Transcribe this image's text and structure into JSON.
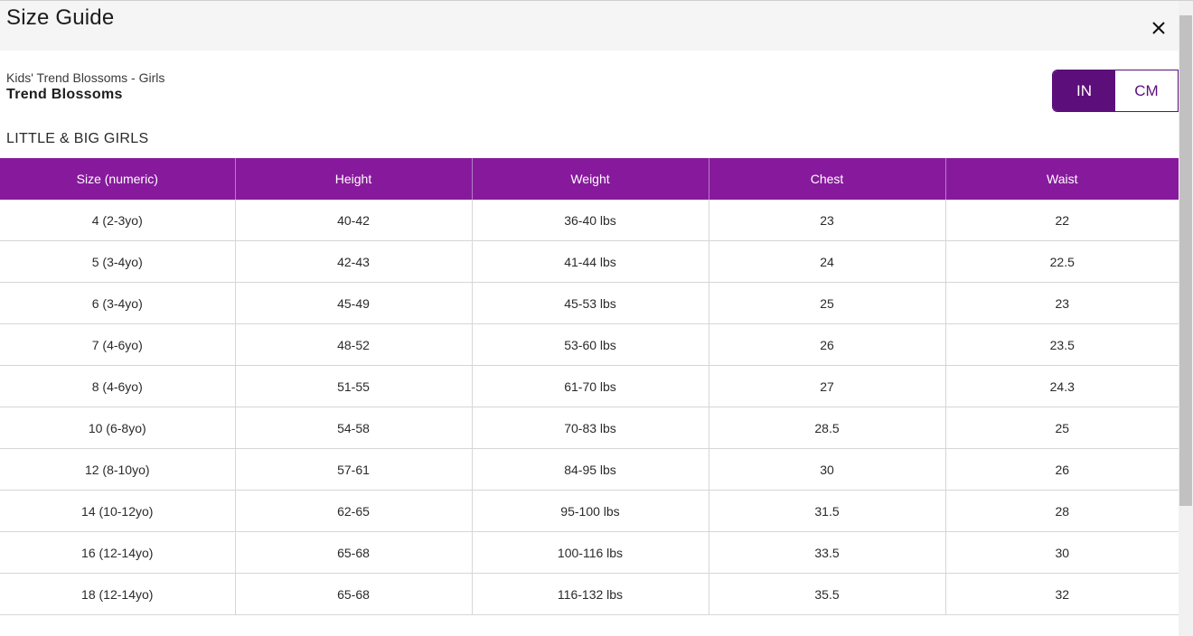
{
  "modal": {
    "title": "Size Guide",
    "close_icon": "close-icon"
  },
  "product": {
    "subtitle": "Kids' Trend Blossoms - Girls",
    "collection": "Trend Blossoms"
  },
  "units": {
    "options": [
      "IN",
      "CM"
    ],
    "selected": "IN"
  },
  "section_title": "LITTLE & BIG GIRLS",
  "colors": {
    "header_bg": "#871a9c",
    "toggle_active": "#5c0f7a"
  },
  "table": {
    "headers": [
      "Size (numeric)",
      "Height",
      "Weight",
      "Chest",
      "Waist"
    ],
    "rows": [
      [
        "4 (2-3yo)",
        "40-42",
        "36-40 lbs",
        "23",
        "22"
      ],
      [
        "5 (3-4yo)",
        "42-43",
        "41-44 lbs",
        "24",
        "22.5"
      ],
      [
        "6 (3-4yo)",
        "45-49",
        "45-53 lbs",
        "25",
        "23"
      ],
      [
        "7 (4-6yo)",
        "48-52",
        "53-60 lbs",
        "26",
        "23.5"
      ],
      [
        "8 (4-6yo)",
        "51-55",
        "61-70 lbs",
        "27",
        "24.3"
      ],
      [
        "10 (6-8yo)",
        "54-58",
        "70-83 lbs",
        "28.5",
        "25"
      ],
      [
        "12 (8-10yo)",
        "57-61",
        "84-95 lbs",
        "30",
        "26"
      ],
      [
        "14 (10-12yo)",
        "62-65",
        "95-100 lbs",
        "31.5",
        "28"
      ],
      [
        "16 (12-14yo)",
        "65-68",
        "100-116 lbs",
        "33.5",
        "30"
      ],
      [
        "18 (12-14yo)",
        "65-68",
        "116-132 lbs",
        "35.5",
        "32"
      ]
    ]
  }
}
